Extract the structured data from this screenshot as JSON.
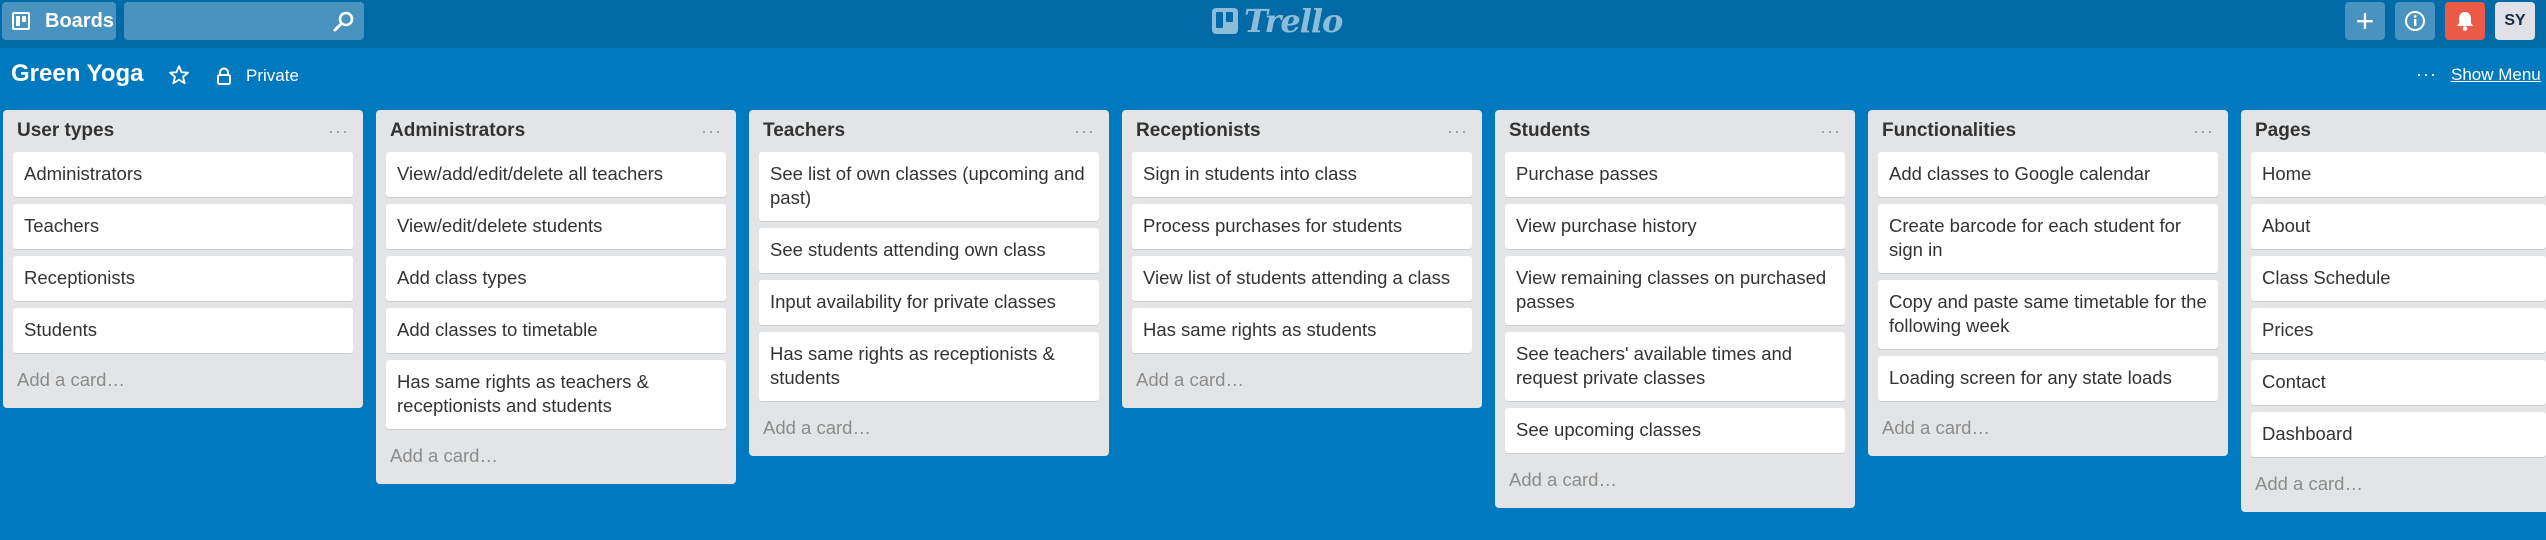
{
  "header": {
    "boards_label": "Boards",
    "search_value": "",
    "logo_text": "Trello",
    "add_label": "+",
    "avatar_initials": "SY"
  },
  "board": {
    "title": "Green Yoga",
    "visibility": "Private",
    "show_menu_label": "Show Menu",
    "more_label": "···"
  },
  "lists": [
    {
      "title": "User types",
      "menu": "···",
      "cards": [
        "Administrators",
        "Teachers",
        "Receptionists",
        "Students"
      ],
      "add_card": "Add a card…"
    },
    {
      "title": "Administrators",
      "menu": "···",
      "cards": [
        "View/add/edit/delete all teachers",
        "View/edit/delete students",
        "Add class types",
        "Add classes to timetable",
        "Has same rights as teachers & receptionists and students"
      ],
      "add_card": "Add a card…"
    },
    {
      "title": "Teachers",
      "menu": "···",
      "cards": [
        "See list of own classes (upcoming and past)",
        "See students attending own class",
        "Input availability for private classes",
        "Has same rights as receptionists & students"
      ],
      "add_card": "Add a card…"
    },
    {
      "title": "Receptionists",
      "menu": "···",
      "cards": [
        "Sign in students into class",
        "Process purchases for students",
        "View list of students attending a class",
        "Has same rights as students"
      ],
      "add_card": "Add a card…"
    },
    {
      "title": "Students",
      "menu": "···",
      "cards": [
        "Purchase passes",
        "View purchase history",
        "View remaining classes on purchased passes",
        "See teachers' available times and request private classes",
        "See upcoming classes"
      ],
      "add_card": "Add a card…"
    },
    {
      "title": "Functionalities",
      "menu": "···",
      "cards": [
        "Add classes to Google calendar",
        "Create barcode for each student for sign in",
        "Copy and paste same timetable for the following week",
        "Loading screen for any state loads"
      ],
      "add_card": "Add a card…"
    },
    {
      "title": "Pages",
      "menu": "···",
      "cards": [
        "Home",
        "About",
        "Class Schedule",
        "Prices",
        "Contact",
        "Dashboard"
      ],
      "add_card": "Add a card…"
    }
  ],
  "colors": {
    "board_bg": "#0079bf",
    "topbar_bg": "#026aa7",
    "list_bg": "#e2e4e6",
    "notification_red": "#eb5a46"
  }
}
